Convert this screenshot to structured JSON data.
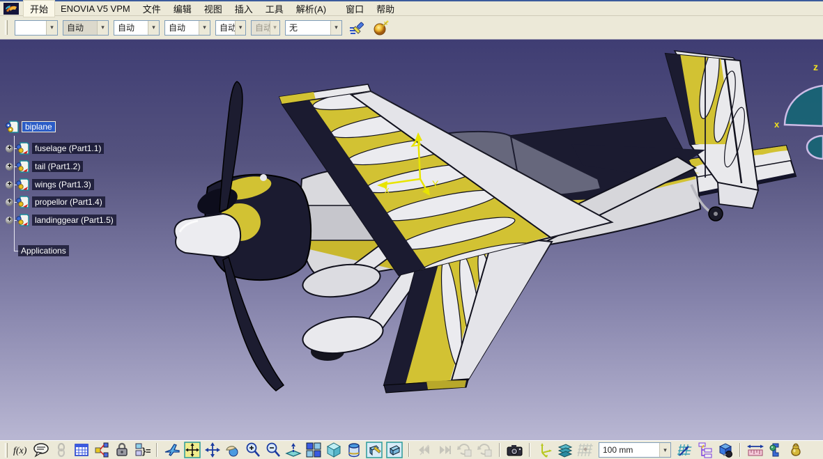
{
  "menubar": {
    "app_icon": "catia-app-icon",
    "items": [
      "开始",
      "ENOVIA V5 VPM",
      "文件",
      "编辑",
      "视图",
      "插入",
      "工具",
      "解析(A)",
      "窗口",
      "帮助"
    ],
    "active_item": "开始"
  },
  "graphics_toolbar": {
    "combos": [
      {
        "name": "color-combo",
        "value": "",
        "disabled": false
      },
      {
        "name": "auto-combo-1",
        "value": "自动",
        "disabled": false
      },
      {
        "name": "auto-combo-2",
        "value": "自动",
        "disabled": false
      },
      {
        "name": "auto-combo-3",
        "value": "自动",
        "disabled": false
      },
      {
        "name": "auto-combo-4",
        "value": "自动",
        "disabled": false
      },
      {
        "name": "auto-combo-5",
        "value": "自动",
        "disabled": true
      },
      {
        "name": "none-combo",
        "value": "无",
        "disabled": false
      }
    ],
    "buttons": [
      "painter-icon",
      "material-wizard-icon"
    ]
  },
  "tree": {
    "root": {
      "label": "biplane",
      "selected": true
    },
    "children": [
      {
        "label": "fuselage (Part1.1)"
      },
      {
        "label": "tail (Part1.2)"
      },
      {
        "label": "wings (Part1.3)"
      },
      {
        "label": "propellor (Part1.4)"
      },
      {
        "label": "landinggear (Part1.5)"
      }
    ],
    "footer": "Applications"
  },
  "viewport": {
    "axis_triad": {
      "x": "x",
      "y": "Y",
      "z": "z"
    },
    "compass": {
      "x": "x",
      "z": "z"
    },
    "background_top": "#3f3d73",
    "background_bottom": "#b9b7d3"
  },
  "model": {
    "name": "biplane",
    "description": "Aerobatic model airplane, dark navy / yellow / white scalloped paint scheme, viewed from front-left",
    "parts": [
      "fuselage",
      "tail",
      "wings",
      "propellor",
      "landinggear"
    ],
    "colors": {
      "dark": "#1b1b30",
      "yellow": "#d2c233",
      "light": "#e9e9ec",
      "gray": "#c9c9d0",
      "canopy": "rgba(195,198,218,0.45)"
    }
  },
  "status_toolbar": {
    "scale_value": "100 mm",
    "groups": [
      {
        "name": "knowledge",
        "icons": [
          "formula",
          "speech-annotation",
          "link",
          "design-table",
          "dependencies",
          "lock",
          "check-rules"
        ]
      },
      {
        "name": "view",
        "icons": [
          "fly-mode",
          "fit-all-in",
          "pan",
          "rotate",
          "zoom-in",
          "zoom-out",
          "normal-view",
          "quadrant-view",
          "iso-view",
          "hide-show",
          "shading-edges",
          "shading"
        ]
      },
      {
        "name": "simulation",
        "disabled": true,
        "icons": [
          "sim-previous",
          "sim-next",
          "sim-replay",
          "sim-loop"
        ]
      },
      {
        "name": "capture",
        "icons": [
          "camera"
        ]
      },
      {
        "name": "reference",
        "icons": [
          "axis-system",
          "planes",
          "grid"
        ]
      },
      {
        "name": "tools",
        "icons": [
          "snap-grid",
          "structure-tree",
          "catalog"
        ]
      },
      {
        "name": "measure",
        "icons": [
          "measure-between",
          "measure-item",
          "measure-inertia"
        ]
      }
    ]
  }
}
